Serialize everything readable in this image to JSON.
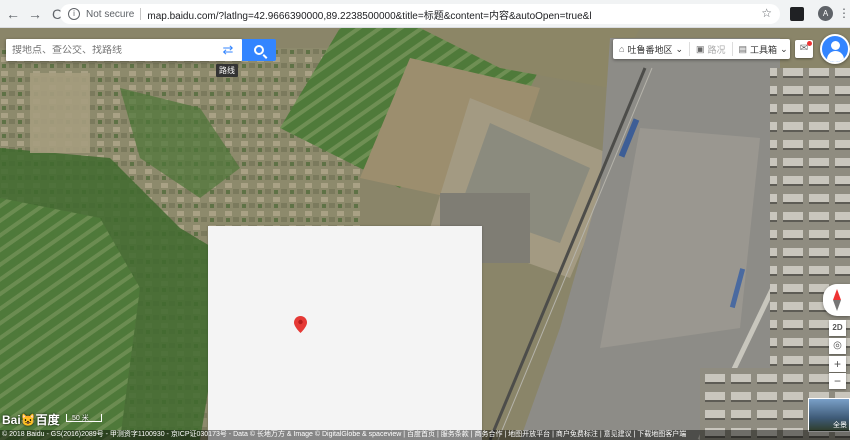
{
  "browser": {
    "back_glyph": "←",
    "forward_glyph": "→",
    "reload_glyph": "C",
    "security_label": "Not secure",
    "url": "map.baidu.com/?latlng=42.9666390000,89.2238500000&title=标题&content=内容&autoOpen=true&l",
    "star_glyph": "☆",
    "profile_initial": "A",
    "menu_glyph": "⋮"
  },
  "search": {
    "placeholder": "搜地点、查公交、找路线",
    "route_tooltip": "路线"
  },
  "toolbar": {
    "city": "吐鲁番地区",
    "city_arrow": "⌄",
    "road_conditions": "路况",
    "toolbox": "工具箱",
    "toolbox_arrow": "⌄"
  },
  "controls": {
    "view_mode": "2D",
    "locate_glyph": "◎",
    "zoom_in": "+",
    "zoom_out": "−",
    "streetview_label": "全景"
  },
  "map": {
    "logo": "Bai😺百度",
    "scale": "50 米",
    "copyright": "© 2018 Baidu - GS(2016)2089号 - 甲测资字1100930 - 京ICP证030173号 - Data © 长地万方 & Image © DigitalGlobe & spaceview | 百度首页 | 服务条款 | 商务合作 | 地图开放平台 | 商户免费标注 | 意见建议 | 下载地图客户端"
  },
  "colors": {
    "accent": "#3385ff",
    "pin": "#e53935",
    "panel": "#f4f4f4"
  }
}
